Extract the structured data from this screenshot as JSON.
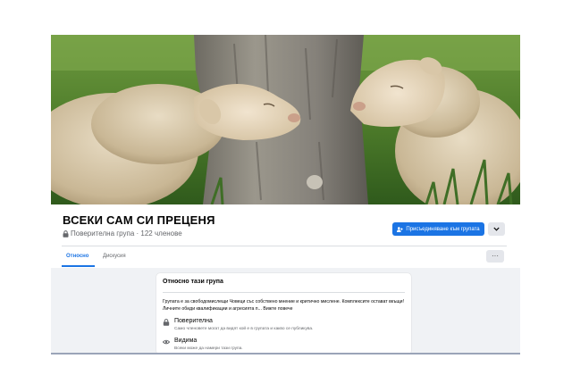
{
  "group": {
    "name": "ВСЕКИ САМ СИ ПРЕЦЕНЯ",
    "meta": "Поверителна група · 122 членове"
  },
  "actions": {
    "join_label": "Присъединяване към групата"
  },
  "tabs": [
    {
      "label": "Относно",
      "active": true
    },
    {
      "label": "Дискусия",
      "active": false
    }
  ],
  "more_label": "···",
  "about": {
    "title": "Относно тази група",
    "description": "Групата е за свободомислещи Човеци със собствено мнение и критично мислене. Комплексите остават вкъщи! Личните обиди квалификации и агресията п... Вижте повече",
    "privacy": {
      "title": "Поверителна",
      "subtitle": "Само членовете могат да видят кой е в групата и какво се публикува."
    },
    "visibility": {
      "title": "Видима",
      "subtitle": "Всеки може да намери тази група."
    }
  },
  "colors": {
    "accent": "#1b74e4",
    "text": "#050505",
    "muted": "#65676b",
    "background": "#f0f2f5"
  }
}
